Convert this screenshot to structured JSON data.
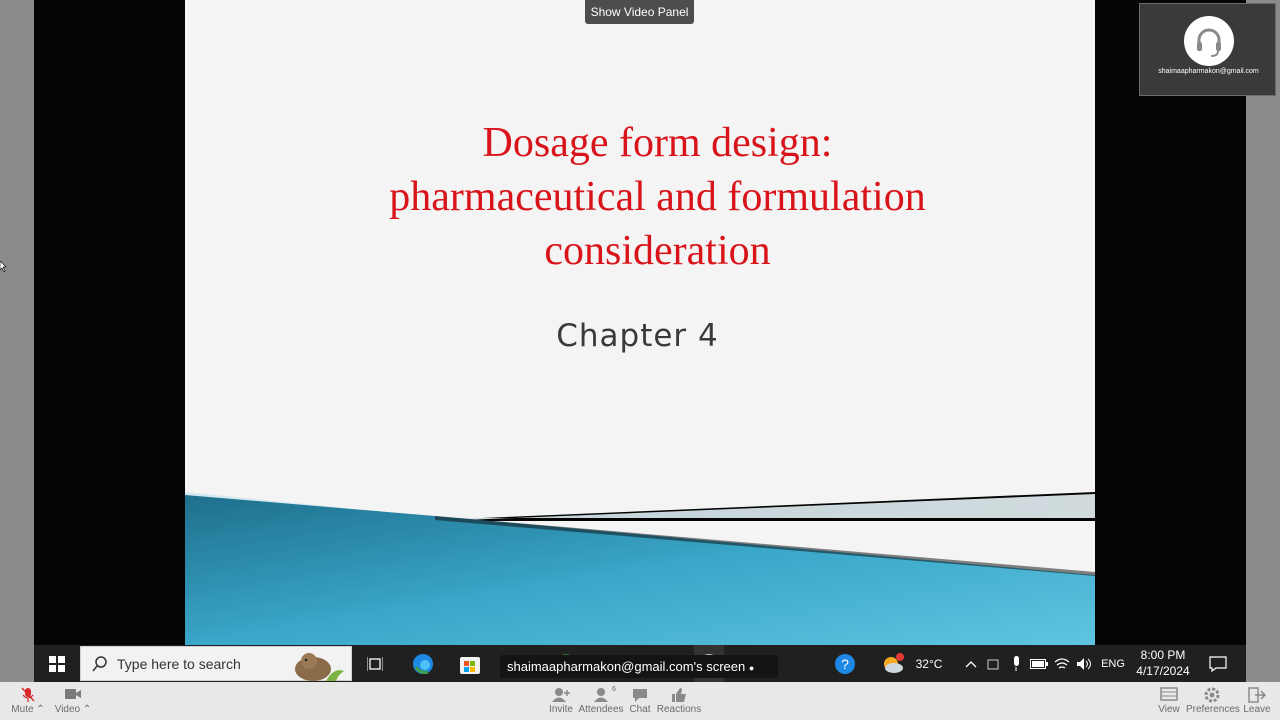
{
  "overlay": {
    "show_video_panel": "Show Video Panel"
  },
  "slide": {
    "title_lines": [
      "Dosage form design:",
      "pharmaceutical and formulation",
      "consideration"
    ],
    "chapter": "Chapter  4"
  },
  "participant": {
    "name": "shaimaapharmakon@gmail.com"
  },
  "taskbar": {
    "search_placeholder": "Type here to search",
    "weather": "32°C",
    "language": "ENG",
    "time": "8:00 PM",
    "date": "4/17/2024",
    "weather_badge": "1"
  },
  "share_banner": "shaimaapharmakon@gmail.com's screen",
  "meeting_bar": {
    "mute": "Mute",
    "video": "Video",
    "invite": "Invite",
    "attendees": "Attendees",
    "attendees_count": "6",
    "chat": "Chat",
    "reactions": "Reactions",
    "view": "View",
    "preferences": "Preferences",
    "leave": "Leave"
  },
  "colors": {
    "title_red": "#d8141a",
    "mute_red": "#d9292b",
    "taskbar": "#202020",
    "meeting_bar": "#e8e8e8"
  }
}
